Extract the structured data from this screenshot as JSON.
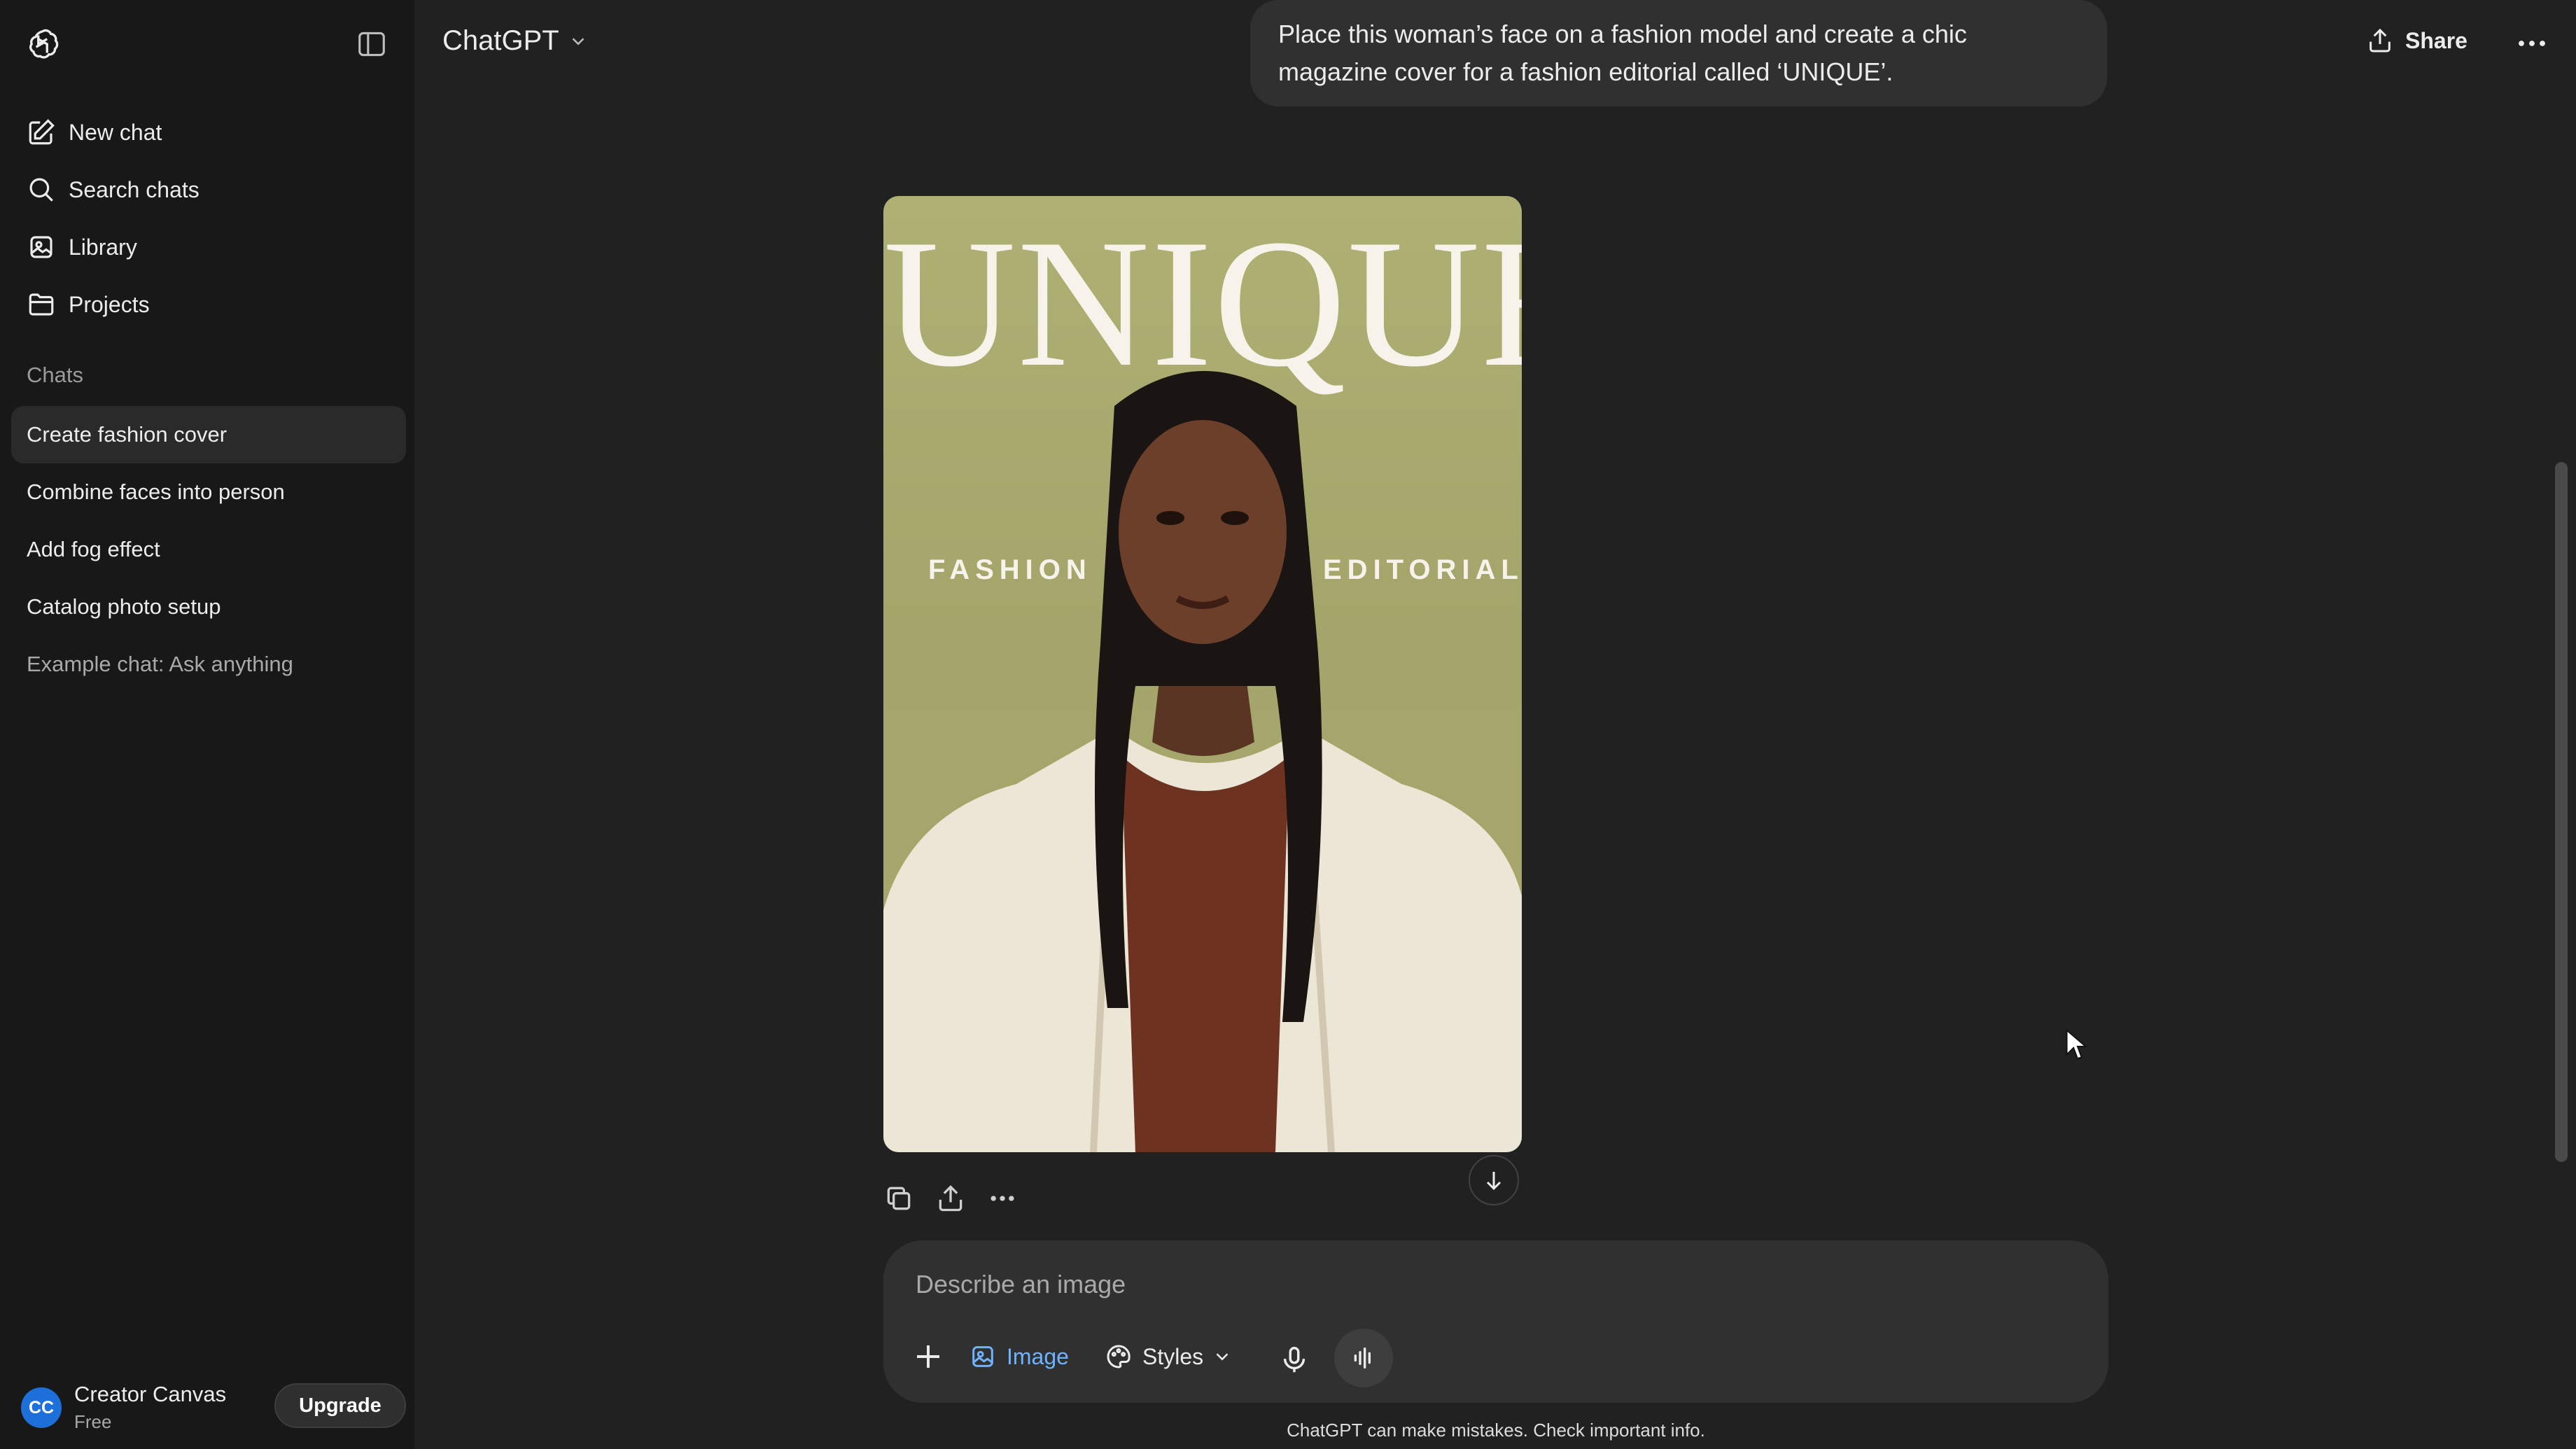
{
  "sidebar": {
    "nav": [
      {
        "label": "New chat",
        "icon": "edit-icon"
      },
      {
        "label": "Search chats",
        "icon": "search-icon"
      },
      {
        "label": "Library",
        "icon": "library-icon"
      },
      {
        "label": "Projects",
        "icon": "folder-icon"
      }
    ],
    "section_label": "Chats",
    "chats": [
      {
        "label": "Create fashion cover"
      },
      {
        "label": "Combine faces into person"
      },
      {
        "label": "Add fog effect"
      },
      {
        "label": "Catalog photo setup"
      },
      {
        "label": "Example chat: Ask anything"
      }
    ],
    "user": {
      "initials": "CC",
      "name": "Creator Canvas",
      "plan": "Free",
      "upgrade_label": "Upgrade"
    }
  },
  "header": {
    "model": "ChatGPT",
    "share_label": "Share"
  },
  "conversation": {
    "user_message": "Place this woman’s face on a fashion model and create a chic magazine cover for a fashion editorial called ‘UNIQUE’.",
    "cover": {
      "title": "UNIQUE",
      "subtitle_left": "FASHION",
      "subtitle_right": "EDITORIAL"
    }
  },
  "composer": {
    "placeholder": "Describe an image",
    "image_label": "Image",
    "styles_label": "Styles"
  },
  "disclaimer": "ChatGPT can make mistakes. Check important info.",
  "colors": {
    "background": "#212121",
    "sidebar": "#181818",
    "accent": "#6fb3ff",
    "avatar": "#1d6fd9"
  }
}
